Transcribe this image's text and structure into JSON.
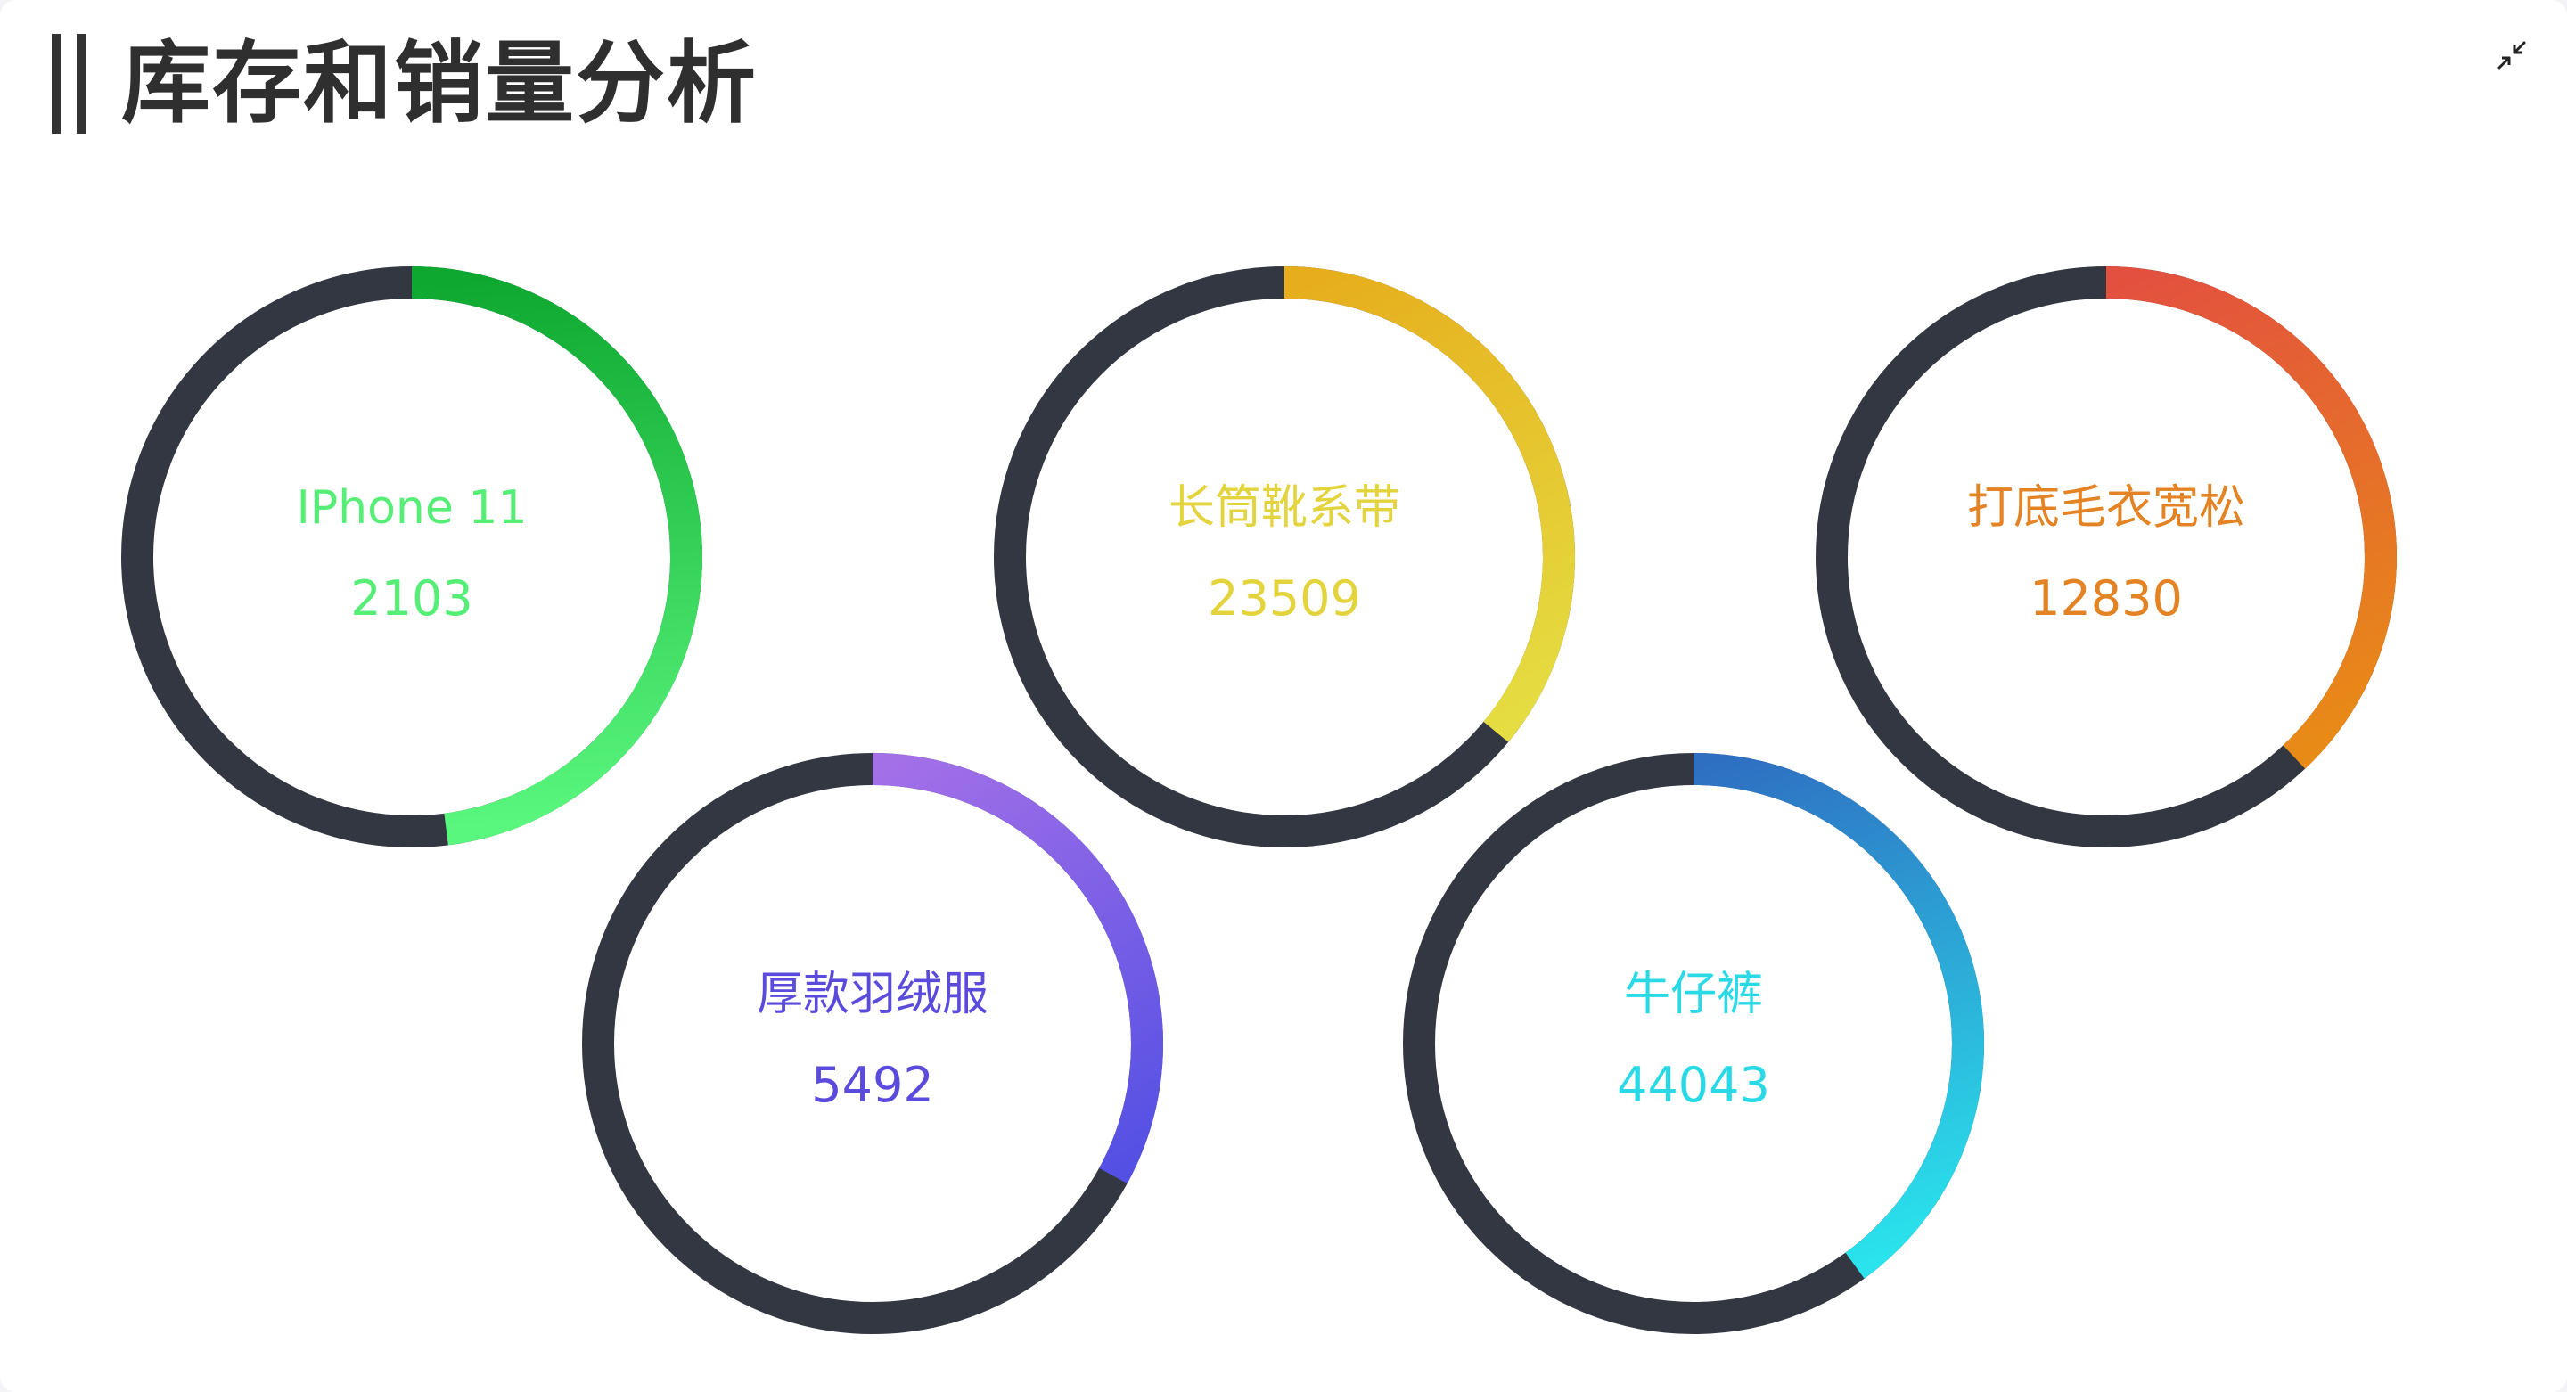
{
  "header": {
    "title": "库存和销量分析"
  },
  "toolbar": {
    "collapse_icon": "collapse-arrows-icon"
  },
  "chart_data": {
    "type": "pie",
    "track_color": "#333742",
    "items": [
      {
        "name": "IPhone 11",
        "value": 2103,
        "progress": 0.48,
        "color_start": "#0ea830",
        "color_end": "#5af77e",
        "text_color": "#56ee77"
      },
      {
        "name": "长筒靴系带",
        "value": 23509,
        "progress": 0.36,
        "color_start": "#e6ad1c",
        "color_end": "#e5dd42",
        "text_color": "#e3d43e"
      },
      {
        "name": "打底毛衣宽松",
        "value": 12830,
        "progress": 0.38,
        "color_start": "#e3503f",
        "color_end": "#e88b16",
        "text_color": "#e48324"
      },
      {
        "name": "厚款羽绒服",
        "value": 5492,
        "progress": 0.33,
        "color_start": "#a470e8",
        "color_end": "#5450e4",
        "text_color": "#5b4bdc"
      },
      {
        "name": "牛仔裤",
        "value": 44043,
        "progress": 0.4,
        "color_start": "#2e6fc2",
        "color_end": "#2ae3ec",
        "text_color": "#2ad9e6"
      }
    ]
  }
}
